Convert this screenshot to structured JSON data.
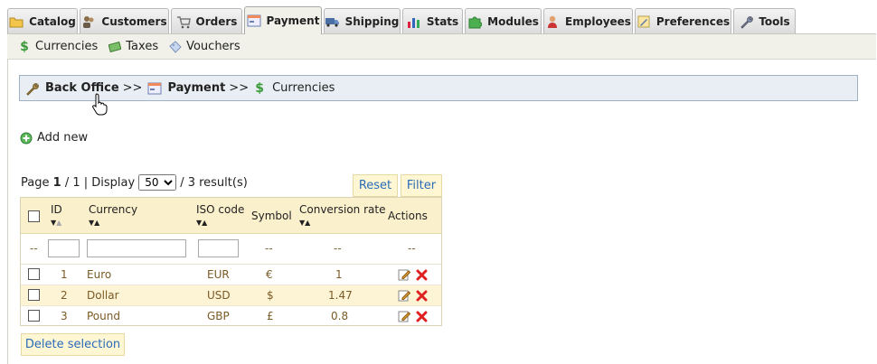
{
  "tabs": [
    {
      "label": "Catalog",
      "icon": "folder-icon"
    },
    {
      "label": "Customers",
      "icon": "customers-icon"
    },
    {
      "label": "Orders",
      "icon": "cart-icon"
    },
    {
      "label": "Payment",
      "icon": "payment-icon",
      "active": true
    },
    {
      "label": "Shipping",
      "icon": "truck-icon"
    },
    {
      "label": "Stats",
      "icon": "stats-icon"
    },
    {
      "label": "Modules",
      "icon": "puzzle-icon"
    },
    {
      "label": "Employees",
      "icon": "employee-icon"
    },
    {
      "label": "Preferences",
      "icon": "preferences-icon"
    },
    {
      "label": "Tools",
      "icon": "wrench-icon"
    }
  ],
  "submenu": [
    {
      "label": "Currencies",
      "icon": "dollar-icon"
    },
    {
      "label": "Taxes",
      "icon": "money-icon"
    },
    {
      "label": "Vouchers",
      "icon": "voucher-icon"
    }
  ],
  "breadcrumb": {
    "root": "Back Office",
    "section": "Payment",
    "current": "Currencies",
    "separator": ">>"
  },
  "add_new": "Add new",
  "pager": {
    "page_label": "Page",
    "page": "1",
    "of": "/ 1",
    "display_label": "| Display",
    "display_value": "50",
    "results": "/ 3 result(s)"
  },
  "buttons": {
    "reset": "Reset",
    "filter": "Filter",
    "delete_selection": "Delete selection"
  },
  "table": {
    "headers": {
      "id": "ID",
      "currency": "Currency",
      "iso": "ISO code",
      "symbol": "Symbol",
      "rate": "Conversion rate",
      "actions": "Actions"
    },
    "filter_placeholder": "--",
    "rows": [
      {
        "id": "1",
        "currency": "Euro",
        "iso": "EUR",
        "symbol": "€",
        "rate": "1"
      },
      {
        "id": "2",
        "currency": "Dollar",
        "iso": "USD",
        "symbol": "$",
        "rate": "1.47"
      },
      {
        "id": "3",
        "currency": "Pound",
        "iso": "GBP",
        "symbol": "£",
        "rate": "0.8"
      }
    ]
  },
  "colors": {
    "accent_link": "#2a6bb8",
    "button_bg": "#fff6d3",
    "header_bg": "#fbf0cc",
    "alt_row": "#fdf4d6"
  }
}
